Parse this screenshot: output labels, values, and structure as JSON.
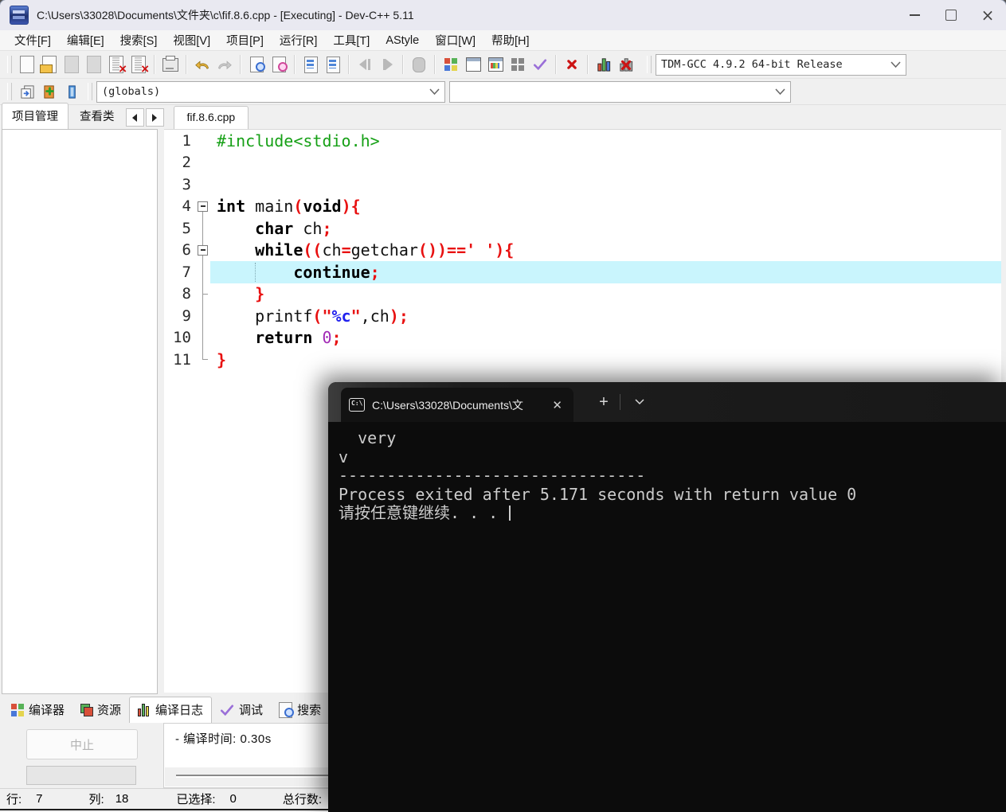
{
  "window": {
    "title": "C:\\Users\\33028\\Documents\\文件夹\\c\\fif.8.6.cpp - [Executing] - Dev-C++ 5.11"
  },
  "menu": {
    "items": [
      "文件[F]",
      "编辑[E]",
      "搜索[S]",
      "视图[V]",
      "项目[P]",
      "运行[R]",
      "工具[T]",
      "AStyle",
      "窗口[W]",
      "帮助[H]"
    ]
  },
  "toolbar": {
    "compiler_profile": "TDM-GCC 4.9.2 64-bit Release"
  },
  "toolbar2": {
    "globals": "(globals)",
    "members": ""
  },
  "left_tabs": {
    "project": "项目管理",
    "classes": "查看类"
  },
  "editor": {
    "file_tab": "fif.8.6.cpp",
    "lines": [
      {
        "num": "1",
        "fold": "",
        "segs": [
          {
            "c": "inc",
            "t": "#include<stdio.h>"
          }
        ]
      },
      {
        "num": "2",
        "fold": "",
        "segs": []
      },
      {
        "num": "3",
        "fold": "",
        "segs": []
      },
      {
        "num": "4",
        "fold": "minusf",
        "segs": [
          {
            "c": "kw",
            "t": "int"
          },
          {
            "c": "pl",
            "t": " main"
          },
          {
            "c": "sym",
            "t": "("
          },
          {
            "c": "kw",
            "t": "void"
          },
          {
            "c": "sym",
            "t": "){"
          }
        ]
      },
      {
        "num": "5",
        "fold": "vline",
        "segs": [
          {
            "c": "pl",
            "t": "    "
          },
          {
            "c": "kw",
            "t": "char"
          },
          {
            "c": "pl",
            "t": " ch"
          },
          {
            "c": "sym",
            "t": ";"
          }
        ]
      },
      {
        "num": "6",
        "fold": "minus",
        "segs": [
          {
            "c": "pl",
            "t": "    "
          },
          {
            "c": "kw",
            "t": "while"
          },
          {
            "c": "sym",
            "t": "(("
          },
          {
            "c": "pl",
            "t": "ch"
          },
          {
            "c": "sym",
            "t": "="
          },
          {
            "c": "pl",
            "t": "getchar"
          },
          {
            "c": "sym",
            "t": "())=="
          },
          {
            "c": "str",
            "t": "' '"
          },
          {
            "c": "sym",
            "t": "){"
          }
        ]
      },
      {
        "num": "7",
        "fold": "vline",
        "hl": true,
        "guide": true,
        "segs": [
          {
            "c": "pl",
            "t": "        "
          },
          {
            "c": "kw",
            "t": "continue"
          },
          {
            "c": "sym",
            "t": ";"
          }
        ]
      },
      {
        "num": "8",
        "fold": "tick",
        "segs": [
          {
            "c": "pl",
            "t": "    "
          },
          {
            "c": "sym",
            "t": "}"
          }
        ]
      },
      {
        "num": "9",
        "fold": "vline",
        "segs": [
          {
            "c": "pl",
            "t": "    printf"
          },
          {
            "c": "sym",
            "t": "(\""
          },
          {
            "c": "fmt",
            "t": "%c"
          },
          {
            "c": "sym",
            "t": "\""
          },
          {
            "c": "pl",
            "t": ",ch"
          },
          {
            "c": "sym",
            "t": ");"
          }
        ]
      },
      {
        "num": "10",
        "fold": "vline",
        "segs": [
          {
            "c": "pl",
            "t": "    "
          },
          {
            "c": "kw",
            "t": "return"
          },
          {
            "c": "pl",
            "t": " "
          },
          {
            "c": "num",
            "t": "0"
          },
          {
            "c": "sym",
            "t": ";"
          }
        ]
      },
      {
        "num": "11",
        "fold": "end",
        "segs": [
          {
            "c": "sym",
            "t": "}"
          }
        ]
      }
    ]
  },
  "bottom": {
    "tabs": [
      "编译器",
      "资源",
      "编译日志",
      "调试",
      "搜索"
    ],
    "abort_label": "中止",
    "compile_time": "- 编译时间: 0.30s"
  },
  "status": {
    "line_label": "行:",
    "line": "7",
    "col_label": "列:",
    "col": "18",
    "sel_label": "已选择:",
    "sel": "0",
    "total_label": "总行数:"
  },
  "terminal": {
    "tab_icon_text": "C:\\",
    "tab_title": "C:\\Users\\33028\\Documents\\文",
    "lines": [
      "  very",
      "v",
      "--------------------------------",
      "Process exited after 5.171 seconds with return value 0",
      "请按任意键继续. . . "
    ]
  },
  "colors": {
    "line_highlight": "#c9f5fd",
    "syntax_symbol_red": "#e81111",
    "syntax_preprocessor_green": "#16a016",
    "syntax_format_blue": "#2222ee",
    "syntax_number_purple": "#a128b5",
    "terminal_bg": "#0c0c0c",
    "terminal_fg": "#cccccc"
  }
}
